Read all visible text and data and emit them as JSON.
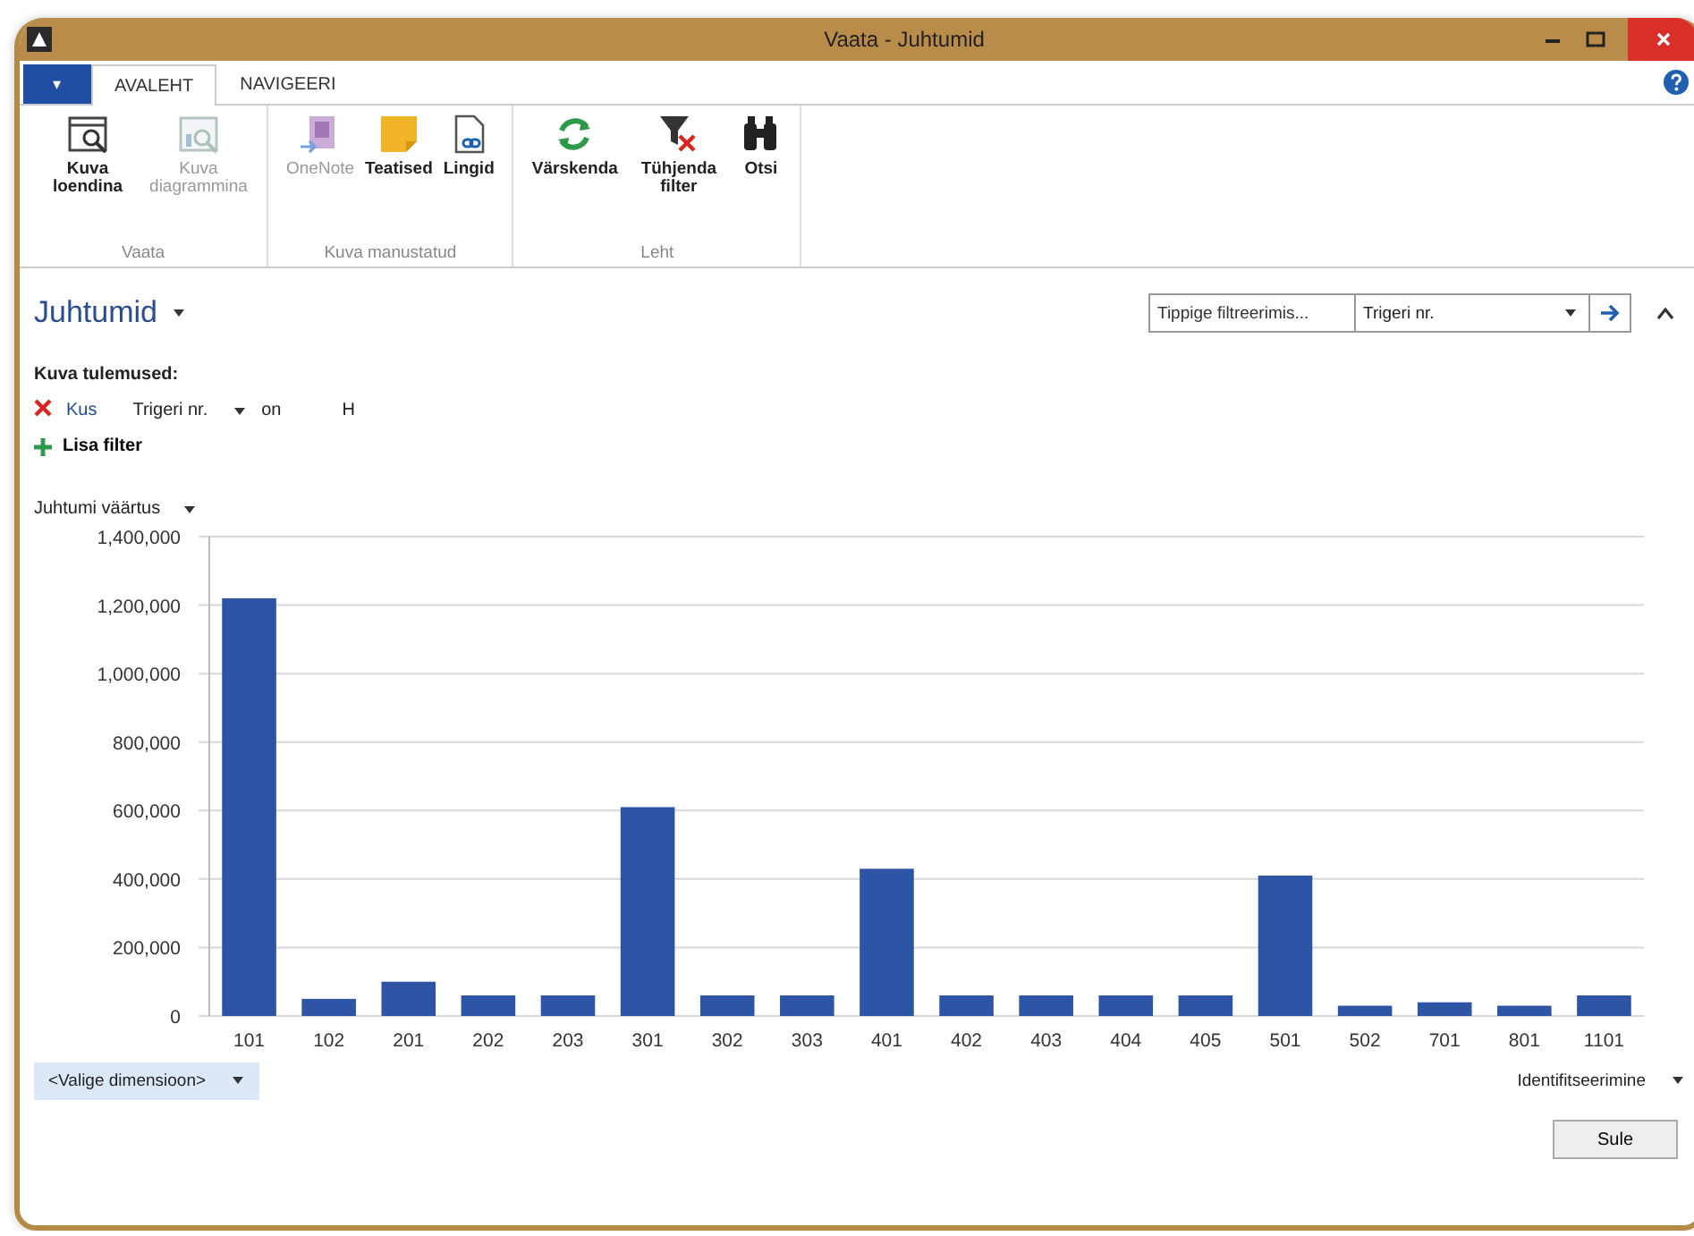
{
  "window": {
    "title": "Vaata - Juhtumid"
  },
  "ribbon": {
    "file_button": "▾",
    "tabs": [
      {
        "label": "AVALEHT",
        "selected": true
      },
      {
        "label": "NAVIGEERI",
        "selected": false
      }
    ],
    "groups": [
      {
        "label": "Vaata",
        "buttons": [
          {
            "label": "Kuva loendina",
            "disabled": false
          },
          {
            "label": "Kuva diagrammina",
            "disabled": true
          }
        ]
      },
      {
        "label": "Kuva manustatud",
        "buttons": [
          {
            "label": "OneNote",
            "disabled": true
          },
          {
            "label": "Teatised",
            "disabled": false
          },
          {
            "label": "Lingid",
            "disabled": false
          }
        ]
      },
      {
        "label": "Leht",
        "buttons": [
          {
            "label": "Värskenda",
            "disabled": false
          },
          {
            "label": "Tühjenda filter",
            "disabled": false
          },
          {
            "label": "Otsi",
            "disabled": false
          }
        ]
      }
    ]
  },
  "page": {
    "title": "Juhtumid",
    "quick_filter": {
      "placeholder": "Tippige filtreerimis...",
      "field": "Trigeri nr."
    }
  },
  "filters": {
    "heading": "Kuva tulemused:",
    "rows": [
      {
        "label": "Kus",
        "field": "Trigeri nr.",
        "operator": "on",
        "value": "H"
      }
    ],
    "add": "Lisa filter"
  },
  "chart_data": {
    "type": "bar",
    "grid": true,
    "categories": [
      "101",
      "102",
      "201",
      "202",
      "203",
      "301",
      "302",
      "303",
      "401",
      "402",
      "403",
      "404",
      "405",
      "501",
      "502",
      "701",
      "801",
      "1101"
    ],
    "series": [
      {
        "name": "Juhtumi väärtus",
        "color": "#2e55a5",
        "values": [
          1220000,
          50000,
          100000,
          60000,
          60000,
          610000,
          60000,
          60000,
          430000,
          60000,
          60000,
          60000,
          60000,
          410000,
          30000,
          40000,
          30000,
          60000
        ]
      }
    ],
    "ylim": [
      0,
      1400000
    ],
    "yticks": [
      {
        "value": 0,
        "label": "0"
      },
      {
        "value": 200000,
        "label": "200,000"
      },
      {
        "value": 400000,
        "label": "400,000"
      },
      {
        "value": 600000,
        "label": "600,000"
      },
      {
        "value": 800000,
        "label": "800,000"
      },
      {
        "value": 1000000,
        "label": "1,000,000"
      },
      {
        "value": 1200000,
        "label": "1,200,000"
      },
      {
        "value": 1400000,
        "label": "1,400,000"
      }
    ]
  },
  "dimension": "<Valige dimensioon>",
  "x_dimension": "Identifitseerimine",
  "buttons": [
    "Sule"
  ]
}
